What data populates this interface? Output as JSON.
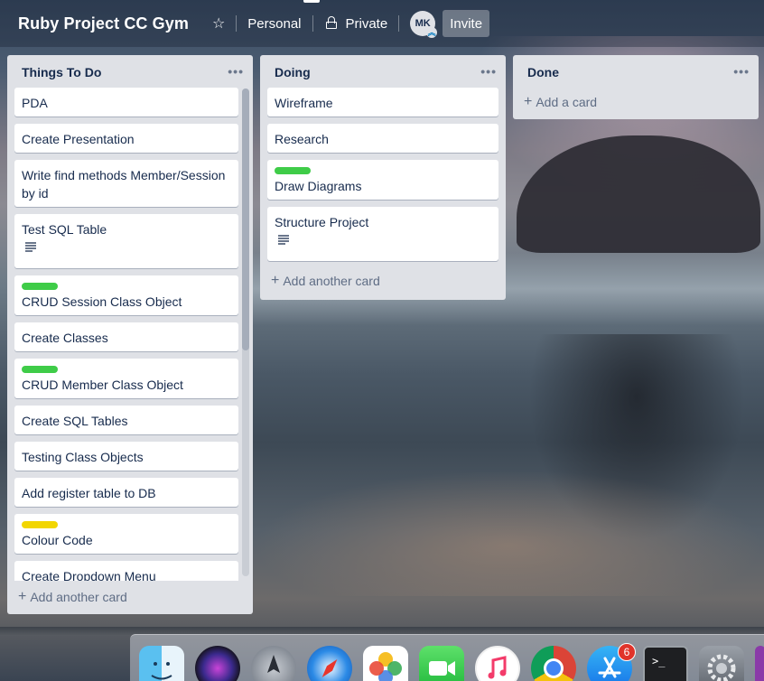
{
  "board": {
    "title": "Ruby Project CC Gym",
    "team": "Personal",
    "visibility": "Private",
    "avatar_initials": "MK",
    "invite_label": "Invite"
  },
  "colors": {
    "label_green": "#3fcc48",
    "label_yellow": "#f2d600",
    "list_bg": "#dfe1e6"
  },
  "lists": [
    {
      "title": "Things To Do",
      "cards": [
        {
          "text": "PDA"
        },
        {
          "text": "Create Presentation"
        },
        {
          "text": "Write find methods Member/Session by id"
        },
        {
          "text": "Test SQL Table",
          "has_description": true
        },
        {
          "text": "CRUD Session Class Object",
          "label": "green"
        },
        {
          "text": "Create Classes"
        },
        {
          "text": "CRUD Member Class Object",
          "label": "green"
        },
        {
          "text": "Create SQL Tables"
        },
        {
          "text": "Testing Class Objects"
        },
        {
          "text": "Add register table to DB"
        },
        {
          "text": "Colour Code",
          "label": "yellow"
        },
        {
          "text": "Create Dropdown Menu"
        }
      ],
      "add_label": "Add another card"
    },
    {
      "title": "Doing",
      "cards": [
        {
          "text": "Wireframe"
        },
        {
          "text": "Research"
        },
        {
          "text": "Draw Diagrams",
          "label": "green"
        },
        {
          "text": "Structure Project",
          "has_description": true
        }
      ],
      "add_label": "Add another card"
    },
    {
      "title": "Done",
      "cards": [],
      "add_label": "Add a card"
    }
  ],
  "dock": {
    "apps": [
      "finder-icon",
      "siri-icon",
      "launchpad-icon",
      "safari-icon",
      "photos-icon",
      "facetime-icon",
      "itunes-icon",
      "chrome-icon",
      "app-store-icon",
      "terminal-icon",
      "system-preferences-icon"
    ],
    "app_store_badge": "6",
    "terminal_prompt": ">_"
  }
}
